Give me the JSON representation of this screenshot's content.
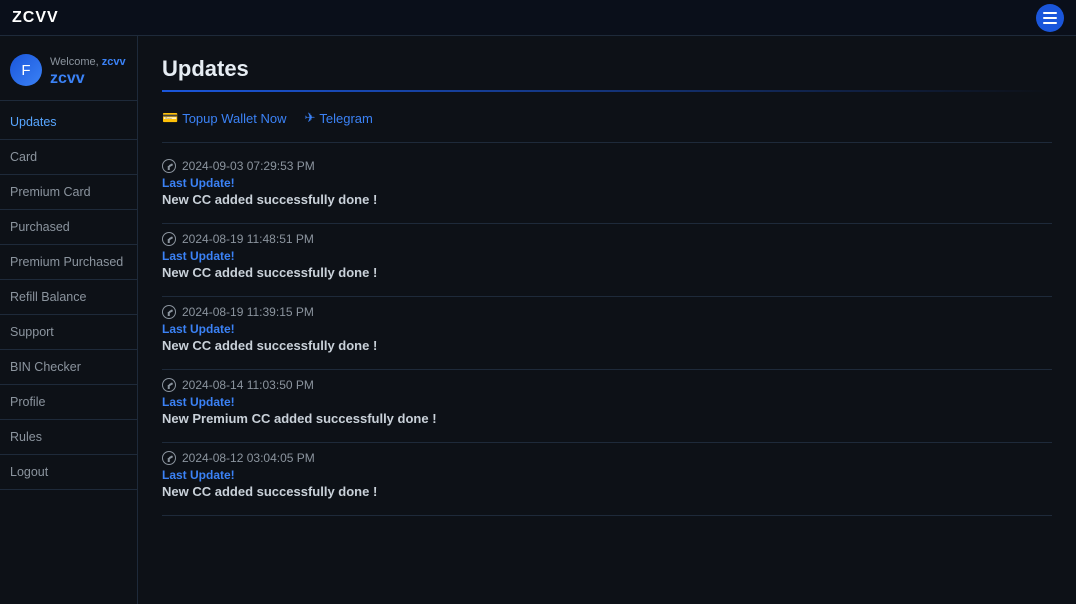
{
  "navbar": {
    "logo": "ZCVV",
    "hamburger_label": "menu"
  },
  "sidebar": {
    "welcome_prefix": "Welcome,",
    "username": "zcvv",
    "avatar_icon": "F",
    "items": [
      {
        "label": "Updates",
        "id": "updates",
        "active": true
      },
      {
        "label": "Card",
        "id": "card",
        "active": false
      },
      {
        "label": "Premium Card",
        "id": "premium-card",
        "active": false
      },
      {
        "label": "Purchased",
        "id": "purchased",
        "active": false
      },
      {
        "label": "Premium Purchased",
        "id": "premium-purchased",
        "active": false
      },
      {
        "label": "Refill Balance",
        "id": "refill-balance",
        "active": false
      },
      {
        "label": "Support",
        "id": "support",
        "active": false
      },
      {
        "label": "BIN Checker",
        "id": "bin-checker",
        "active": false
      },
      {
        "label": "Profile",
        "id": "profile",
        "active": false
      },
      {
        "label": "Rules",
        "id": "rules",
        "active": false
      },
      {
        "label": "Logout",
        "id": "logout",
        "active": false
      }
    ]
  },
  "content": {
    "page_title": "Updates",
    "action_links": [
      {
        "icon": "💳",
        "label": "Topup Wallet Now",
        "id": "topup"
      },
      {
        "icon": "✈",
        "label": "Telegram",
        "id": "telegram"
      }
    ],
    "updates": [
      {
        "timestamp": "2024-09-03 07:29:53 PM",
        "last_update_label": "Last Update!",
        "message": "New CC added successfully done !"
      },
      {
        "timestamp": "2024-08-19 11:48:51 PM",
        "last_update_label": "Last Update!",
        "message": "New CC added successfully done !"
      },
      {
        "timestamp": "2024-08-19 11:39:15 PM",
        "last_update_label": "Last Update!",
        "message": "New CC added successfully done !"
      },
      {
        "timestamp": "2024-08-14 11:03:50 PM",
        "last_update_label": "Last Update!",
        "message": "New Premium CC added successfully done !"
      },
      {
        "timestamp": "2024-08-12 03:04:05 PM",
        "last_update_label": "Last Update!",
        "message": "New CC added successfully done !"
      }
    ]
  }
}
